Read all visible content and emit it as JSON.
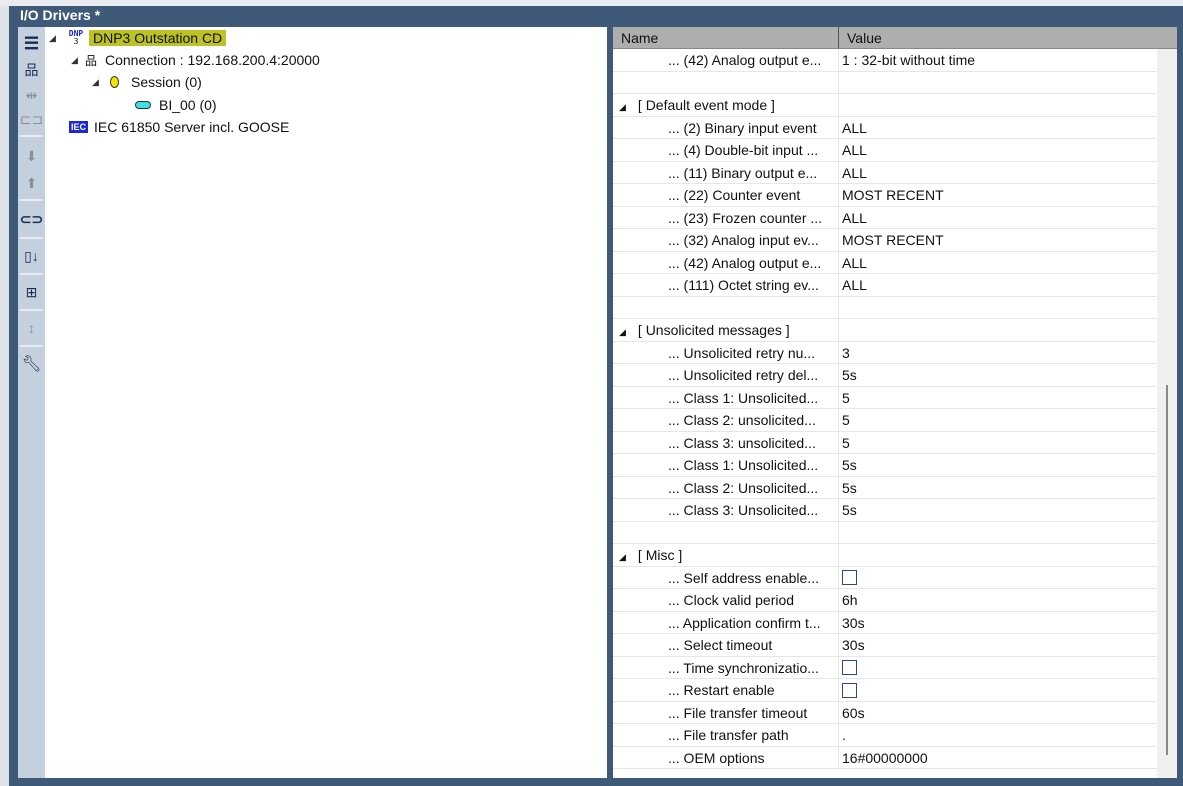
{
  "window": {
    "title": "I/O Drivers *"
  },
  "toolbar": {
    "icons": [
      "collapse-tree-icon",
      "network-icon",
      "link-column-icon",
      "component-icon",
      "move-down-icon",
      "move-up-icon",
      "broken-link-icon",
      "column-down-icon",
      "expand-icon",
      "vertical-move-icon",
      "wrench-icon"
    ]
  },
  "tree": {
    "dnp3": {
      "label": "DNP3 Outstation CD",
      "icon_text": "DNP",
      "icon_num": "3"
    },
    "connection": "Connection : 192.168.200.4:20000",
    "session": "Session (0)",
    "bi": "BI_00 (0)",
    "iec": {
      "label": "IEC 61850 Server incl. GOOSE",
      "icon_text": "IEC"
    }
  },
  "grid": {
    "headers": {
      "name": "Name",
      "value": "Value"
    },
    "rows": [
      {
        "name": "... (42) Analog output e...",
        "value": "1 : 32-bit without time"
      },
      {
        "name": "",
        "value": ""
      },
      {
        "category": "[ Default event mode ]"
      },
      {
        "name": "... (2) Binary input event",
        "value": "ALL"
      },
      {
        "name": "... (4) Double-bit input ...",
        "value": "ALL"
      },
      {
        "name": "... (11) Binary output e...",
        "value": "ALL"
      },
      {
        "name": "... (22) Counter event",
        "value": "MOST RECENT"
      },
      {
        "name": "... (23) Frozen counter ...",
        "value": "ALL"
      },
      {
        "name": "... (32) Analog input ev...",
        "value": "MOST RECENT"
      },
      {
        "name": "... (42) Analog output e...",
        "value": "ALL"
      },
      {
        "name": "... (111) Octet string ev...",
        "value": "ALL"
      },
      {
        "name": "",
        "value": ""
      },
      {
        "category": "[ Unsolicited messages ]"
      },
      {
        "name": "... Unsolicited retry nu...",
        "value": "3"
      },
      {
        "name": "... Unsolicited retry del...",
        "value": "5s"
      },
      {
        "name": "... Class 1: Unsolicited...",
        "value": "5"
      },
      {
        "name": "... Class 2: unsolicited...",
        "value": "5"
      },
      {
        "name": "... Class 3: unsolicited...",
        "value": "5"
      },
      {
        "name": "... Class 1: Unsolicited...",
        "value": "5s"
      },
      {
        "name": "... Class 2: Unsolicited...",
        "value": "5s"
      },
      {
        "name": "... Class 3: Unsolicited...",
        "value": "5s"
      },
      {
        "name": "",
        "value": ""
      },
      {
        "category": "[ Misc ]"
      },
      {
        "name": "... Self address enable...",
        "checkbox": false
      },
      {
        "name": "... Clock valid period",
        "value": "6h"
      },
      {
        "name": "... Application confirm t...",
        "value": "30s"
      },
      {
        "name": "... Select timeout",
        "value": "30s"
      },
      {
        "name": "... Time synchronizatio...",
        "checkbox": false
      },
      {
        "name": "... Restart enable",
        "checkbox": false
      },
      {
        "name": "... File transfer timeout",
        "value": "60s"
      },
      {
        "name": "... File transfer path",
        "value": "."
      },
      {
        "name": "... OEM options",
        "value": "16#00000000"
      }
    ]
  }
}
